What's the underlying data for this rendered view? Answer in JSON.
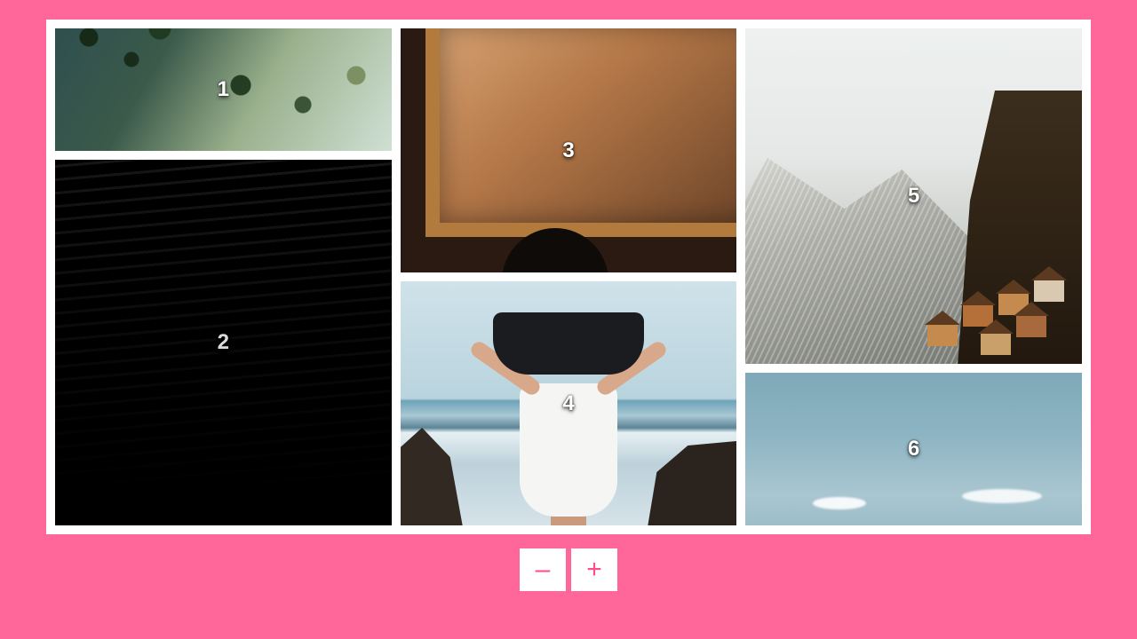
{
  "gallery": {
    "tiles": [
      {
        "label": "1"
      },
      {
        "label": "2"
      },
      {
        "label": "3"
      },
      {
        "label": "4"
      },
      {
        "label": "5"
      },
      {
        "label": "6"
      }
    ]
  },
  "controls": {
    "minus_label": "–",
    "plus_label": "+"
  },
  "colors": {
    "page_bg": "#ff6699",
    "frame_bg": "#ffffff",
    "button_fg": "#ff4d88"
  }
}
